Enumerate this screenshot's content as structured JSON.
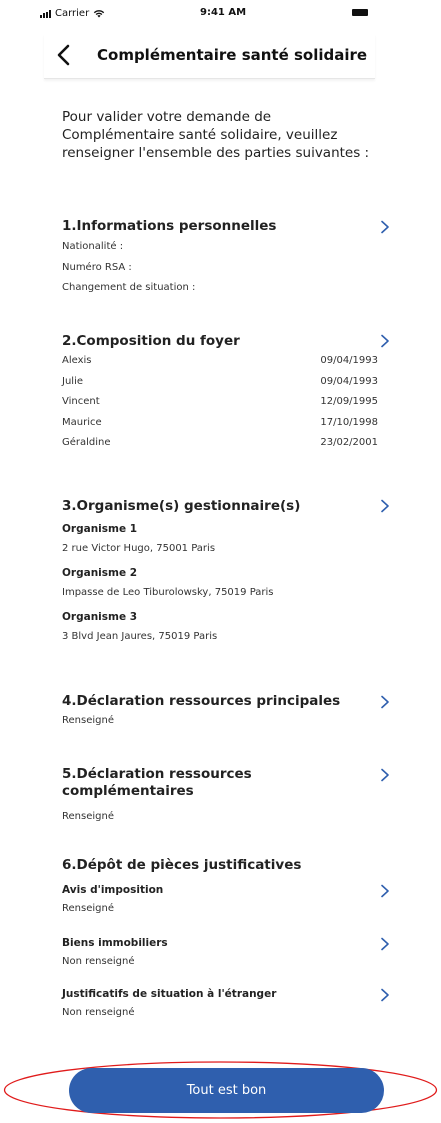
{
  "status_bar": {
    "carrier": "Carrier",
    "time": "9:41 AM"
  },
  "nav": {
    "title": "Complémentaire santé solidaire",
    "back_icon": "chevron-left-icon"
  },
  "intro": "Pour valider votre demande de Complémentaire santé solidaire, veuillez renseigner l'ensemble des parties suivantes :",
  "sections": {
    "personal": {
      "title": "1.Informations personnelles",
      "rows": [
        "Nationalité :",
        "Numéro RSA :",
        "Changement de situation :"
      ]
    },
    "household": {
      "title": "2.Composition du foyer",
      "members": [
        {
          "name": "Alexis",
          "date": "09/04/1993"
        },
        {
          "name": "Julie",
          "date": "09/04/1993"
        },
        {
          "name": "Vincent",
          "date": "12/09/1995"
        },
        {
          "name": "Maurice",
          "date": "17/10/1998"
        },
        {
          "name": "Géraldine",
          "date": "23/02/2001"
        }
      ]
    },
    "organisms": {
      "title": "3.Organisme(s) gestionnaire(s)",
      "items": [
        {
          "label": "Organisme 1",
          "address": "2 rue Victor Hugo,  75001 Paris"
        },
        {
          "label": "Organisme 2",
          "address": "Impasse de Leo Tiburolowsky,  75019 Paris"
        },
        {
          "label": "Organisme 3",
          "address": "3 Blvd Jean Jaures,  75019 Paris"
        }
      ]
    },
    "main_resources": {
      "title": "4.Déclaration ressources principales",
      "status": "Renseigné"
    },
    "extra_resources": {
      "title": "5.Déclaration ressources complémentaires",
      "status": "Renseigné"
    },
    "documents": {
      "title": "6.Dépôt de pièces justificatives",
      "items": [
        {
          "label": "Avis d'imposition",
          "status": "Renseigné"
        },
        {
          "label": "Biens immobiliers",
          "status": "Non renseigné"
        },
        {
          "label": "Justificatifs de situation à l'étranger",
          "status": "Non renseigné"
        }
      ]
    }
  },
  "cta": {
    "label": "Tout est bon"
  },
  "colors": {
    "primary": "#2f5fae",
    "chevron": "#2f5fae",
    "highlight": "#e01b1b"
  }
}
